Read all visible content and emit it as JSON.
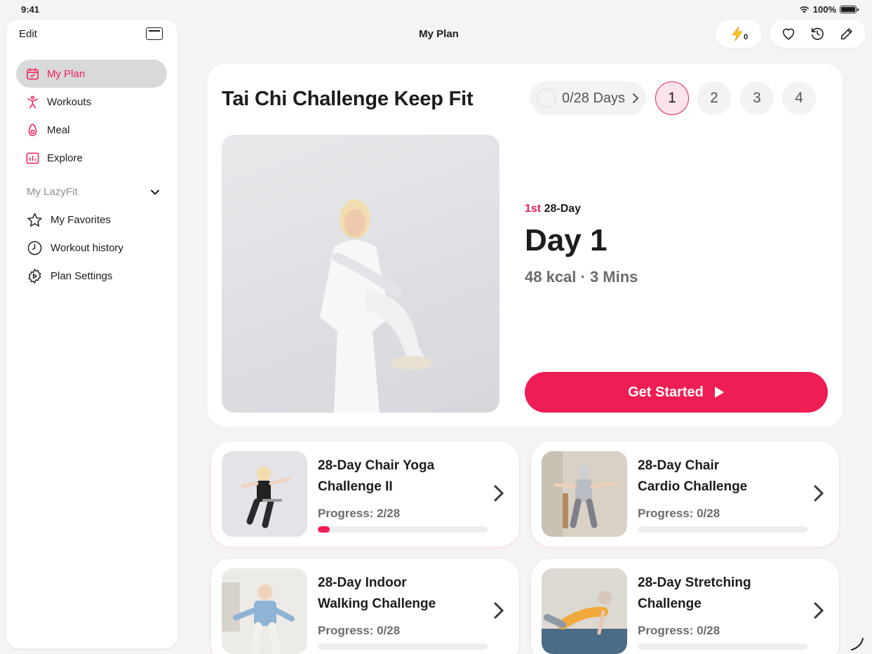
{
  "status_bar": {
    "time": "9:41",
    "battery": "100%"
  },
  "sidebar": {
    "edit_label": "Edit",
    "nav": [
      {
        "label": "My Plan",
        "icon": "calendar-icon",
        "active": true
      },
      {
        "label": "Workouts",
        "icon": "figure-icon",
        "active": false
      },
      {
        "label": "Meal",
        "icon": "avocado-icon",
        "active": false
      },
      {
        "label": "Explore",
        "icon": "chart-icon",
        "active": false
      }
    ],
    "section_title": "My LazyFit",
    "section_items": [
      {
        "label": "My Favorites",
        "icon": "star-icon"
      },
      {
        "label": "Workout history",
        "icon": "clock-icon"
      },
      {
        "label": "Plan Settings",
        "icon": "gear-icon"
      }
    ]
  },
  "header": {
    "title": "My Plan",
    "energy_count": "0"
  },
  "plan": {
    "title": "Tai Chi Challenge Keep Fit",
    "days_progress": "0/28 Days",
    "weeks": [
      "1",
      "2",
      "3",
      "4"
    ],
    "active_week": "1",
    "ordinal": "1st",
    "ordinal_suffix": "28-Day",
    "day_title": "Day 1",
    "day_meta": "48 kcal · 3 Mins",
    "cta_label": "Get Started"
  },
  "challenges": [
    {
      "title_line1": "28-Day Chair Yoga",
      "title_line2": "Challenge II",
      "progress_text": "Progress: 2/28",
      "progress": 0.0714
    },
    {
      "title_line1": "28-Day Chair",
      "title_line2": "Cardio Challenge",
      "progress_text": "Progress: 0/28",
      "progress": 0
    },
    {
      "title_line1": "28-Day Indoor",
      "title_line2": "Walking Challenge",
      "progress_text": "Progress: 0/28",
      "progress": 0
    },
    {
      "title_line1": "28-Day Stretching",
      "title_line2": "Challenge",
      "progress_text": "Progress: 0/28",
      "progress": 0
    }
  ],
  "colors": {
    "accent": "#ef1d55",
    "background": "#f4f3f5",
    "card": "#ffffff"
  }
}
